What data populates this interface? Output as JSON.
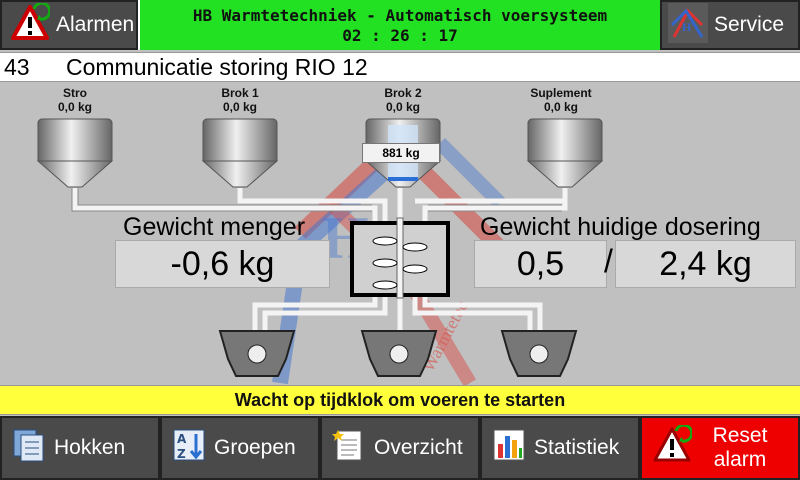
{
  "header": {
    "alarm_label": "Alarmen",
    "title": "HB Warmtetechniek - Automatisch voersysteem",
    "time": "02 : 26 : 17",
    "service_label": "Service"
  },
  "message": {
    "code": "43",
    "text": "Communicatie storing RIO 12"
  },
  "silos": [
    {
      "name": "Stro",
      "weight": "0,0 kg"
    },
    {
      "name": "Brok 1",
      "weight": "0,0 kg"
    },
    {
      "name": "Brok 2",
      "weight": "0,0 kg"
    },
    {
      "name": "Suplement",
      "weight": "0,0 kg"
    }
  ],
  "scale_reading": "881 kg",
  "mixer": {
    "label": "Gewicht menger",
    "value": "-0,6 kg"
  },
  "dosing": {
    "label": "Gewicht huidige dosering",
    "current": "0,5",
    "separator": "/",
    "target": "2,4 kg"
  },
  "watermark_text": "Warmtetec",
  "status": "Wacht op tijdklok om voeren te starten",
  "nav": {
    "hokken": "Hokken",
    "groepen": "Groepen",
    "overzicht": "Overzicht",
    "statistiek": "Statistiek",
    "reset_line1": "Reset",
    "reset_line2": "alarm"
  },
  "colors": {
    "title_bg": "#22e022",
    "status_bg": "#ffff3c",
    "reset_bg": "#ee0000",
    "button_bg": "#4a4a4a"
  },
  "icons": [
    "alarm-warning-icon",
    "service-logo-icon",
    "hokken-icon",
    "groepen-icon",
    "overzicht-icon",
    "statistiek-icon",
    "reset-alarm-icon"
  ]
}
